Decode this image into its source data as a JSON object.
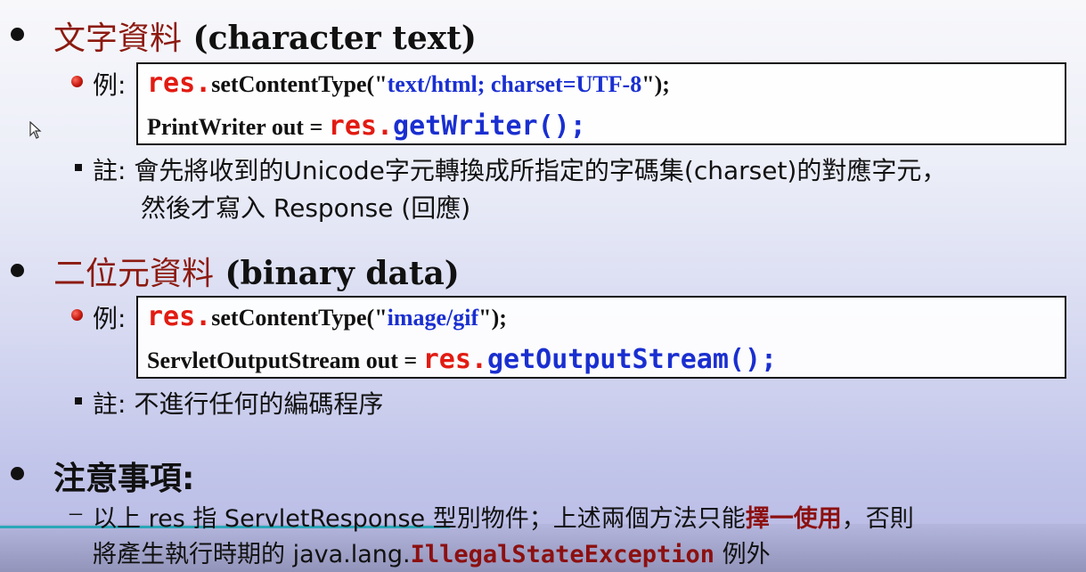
{
  "section1": {
    "heading_zh": "文字資料",
    "heading_en": " (character text)",
    "example_label": "例:",
    "code_line1": {
      "obj": "res.",
      "method": "setContentType(\"",
      "arg": "text/html; charset=UTF-8",
      "end": "\");"
    },
    "code_line2": {
      "prefix": "PrintWriter out = ",
      "obj": "res.",
      "method": "getWriter();"
    },
    "note_label": "註:",
    "note_line1": "會先將收到的Unicode字元轉換成所指定的字碼集(charset)的對應字元，",
    "note_line2": "然後才寫入 Response (回應)"
  },
  "section2": {
    "heading_zh": "二位元資料",
    "heading_en": " (binary data)",
    "example_label": "例:",
    "code_line1": {
      "obj": "res.",
      "method": "setContentType(\"",
      "arg": "image/gif",
      "end": "\");"
    },
    "code_line2": {
      "prefix": "ServletOutputStream out = ",
      "obj": "res.",
      "method": "getOutputStream();"
    },
    "note_label": "註:",
    "note_line1": "不進行任何的編碼程序"
  },
  "section3": {
    "heading": "注意事項:",
    "dash": "–",
    "line1_a": "以上 res 指 ServletResponse 型別物件；上述兩個方法只能",
    "line1_b": "擇一使用",
    "line1_c": "，否則",
    "line2_a": "將產生執行時期的 java.lang.",
    "line2_b": "IllegalStateException",
    "line2_c": " 例外"
  },
  "colors": {
    "heading_red": "#8c1a10",
    "code_red": "#e21b12",
    "code_blue": "#1a2fd0",
    "progress": "#2aa7b8"
  },
  "icons": [
    "bullet-dot",
    "red-ball-bullet",
    "square-bullet",
    "mouse-pointer-icon"
  ]
}
